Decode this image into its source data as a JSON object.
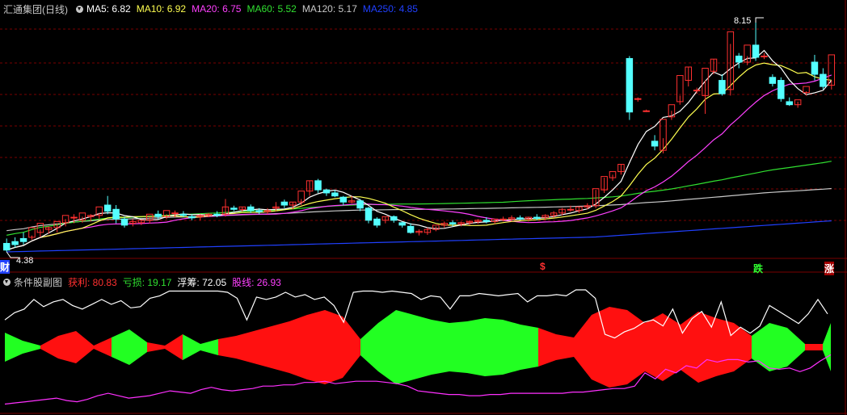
{
  "main_header": {
    "title": "汇通集团(日线)",
    "ma5": "MA5: 6.82",
    "ma10": "MA10: 6.92",
    "ma20": "MA20: 6.75",
    "ma60": "MA60: 5.52",
    "ma120": "MA120: 5.17",
    "ma250": "MA250: 4.85"
  },
  "sub_header": {
    "title": "条件股副图",
    "profit": "获利: 80.83",
    "loss": "亏损: 19.17",
    "float": "浮筹: 72.05",
    "stock_line": "股线: 26.93"
  },
  "annotations": {
    "high_price": "8.15",
    "low_price": "4.38",
    "left_marker": "财",
    "signal_dollar": "$",
    "signal_fall": "跌",
    "signal_rise": "涨"
  },
  "colors": {
    "up": "#ff3030",
    "down": "#54ffff",
    "ma5": "#ffffff",
    "ma10": "#ffff50",
    "ma20": "#ff40ff",
    "ma60": "#30e030",
    "ma120": "#c8c8c8",
    "ma250": "#2040ff",
    "grid": "#7a0000"
  },
  "chart_data": {
    "type": "candlestick",
    "price_range": [
      4.38,
      8.15
    ],
    "candles": [
      [
        4.52,
        4.6,
        4.41,
        4.38
      ],
      [
        4.55,
        4.62,
        4.5,
        4.45
      ],
      [
        4.6,
        4.7,
        4.55,
        4.5
      ],
      [
        4.62,
        4.65,
        4.78,
        4.58
      ],
      [
        4.7,
        4.75,
        4.85,
        4.62
      ],
      [
        4.75,
        4.8,
        4.78,
        4.68
      ],
      [
        4.78,
        4.85,
        4.88,
        4.7
      ],
      [
        4.86,
        4.92,
        4.98,
        4.8
      ],
      [
        4.95,
        5.0,
        4.95,
        4.85
      ],
      [
        4.9,
        4.96,
        5.02,
        4.86
      ],
      [
        4.96,
        5.0,
        4.98,
        4.88
      ],
      [
        4.98,
        5.02,
        5.12,
        4.92
      ],
      [
        5.15,
        5.3,
        5.05,
        5.0
      ],
      [
        5.08,
        5.15,
        4.92,
        4.85
      ],
      [
        4.92,
        4.96,
        4.82,
        4.78
      ],
      [
        4.85,
        4.92,
        4.88,
        4.8
      ],
      [
        4.86,
        4.9,
        4.9,
        4.82
      ],
      [
        4.9,
        4.95,
        5.0,
        4.85
      ],
      [
        5.0,
        5.06,
        4.96,
        4.92
      ],
      [
        4.96,
        5.0,
        5.06,
        4.92
      ],
      [
        5.02,
        5.06,
        5.02,
        4.95
      ],
      [
        5.0,
        5.05,
        4.98,
        4.95
      ],
      [
        4.96,
        5.0,
        4.94,
        4.9
      ],
      [
        4.96,
        5.0,
        4.98,
        4.9
      ],
      [
        4.98,
        5.02,
        5.0,
        4.95
      ],
      [
        5.0,
        5.05,
        4.98,
        4.95
      ],
      [
        5.0,
        5.25,
        5.12,
        4.96
      ],
      [
        5.1,
        5.14,
        5.08,
        5.05
      ],
      [
        5.08,
        5.12,
        5.12,
        5.04
      ],
      [
        5.12,
        5.16,
        5.06,
        5.02
      ],
      [
        5.06,
        5.1,
        5.04,
        5.0
      ],
      [
        5.04,
        5.1,
        5.06,
        5.0
      ],
      [
        5.1,
        5.2,
        5.12,
        5.05
      ],
      [
        5.2,
        5.24,
        5.15,
        5.1
      ],
      [
        5.15,
        5.2,
        5.2,
        5.08
      ],
      [
        5.2,
        5.25,
        5.38,
        5.15
      ],
      [
        5.38,
        5.55,
        5.55,
        5.3
      ],
      [
        5.55,
        5.58,
        5.4,
        5.35
      ],
      [
        5.4,
        5.42,
        5.35,
        5.3
      ],
      [
        5.35,
        5.4,
        5.3,
        5.28
      ],
      [
        5.28,
        5.3,
        5.2,
        5.15
      ],
      [
        5.2,
        5.3,
        5.22,
        5.18
      ],
      [
        5.22,
        5.25,
        5.1,
        5.05
      ],
      [
        5.1,
        5.12,
        4.9,
        4.85
      ],
      [
        4.92,
        4.95,
        4.82,
        4.78
      ],
      [
        4.9,
        4.95,
        4.96,
        4.85
      ],
      [
        4.96,
        4.98,
        4.9,
        4.86
      ],
      [
        4.86,
        4.88,
        4.82,
        4.78
      ],
      [
        4.8,
        4.85,
        4.7,
        4.68
      ],
      [
        4.7,
        4.75,
        4.72,
        4.65
      ],
      [
        4.7,
        4.78,
        4.75,
        4.66
      ],
      [
        4.75,
        4.8,
        4.82,
        4.72
      ],
      [
        4.82,
        4.88,
        4.85,
        4.78
      ],
      [
        4.86,
        4.9,
        4.84,
        4.8
      ],
      [
        4.84,
        4.88,
        4.86,
        4.8
      ],
      [
        4.86,
        4.9,
        4.88,
        4.82
      ],
      [
        4.88,
        4.92,
        4.9,
        4.84
      ],
      [
        4.9,
        4.95,
        4.88,
        4.85
      ],
      [
        4.88,
        4.92,
        4.92,
        4.84
      ],
      [
        4.92,
        4.96,
        4.92,
        4.88
      ],
      [
        4.92,
        4.98,
        4.94,
        4.88
      ],
      [
        4.94,
        4.98,
        4.92,
        4.9
      ],
      [
        4.92,
        4.96,
        4.95,
        4.88
      ],
      [
        4.95,
        5.0,
        4.93,
        4.9
      ],
      [
        4.95,
        5.0,
        4.98,
        4.9
      ],
      [
        4.98,
        5.05,
        5.02,
        4.94
      ],
      [
        5.02,
        5.1,
        5.08,
        4.98
      ],
      [
        5.08,
        5.14,
        5.08,
        5.04
      ],
      [
        5.06,
        5.12,
        5.12,
        5.02
      ],
      [
        5.12,
        5.18,
        5.14,
        5.08
      ],
      [
        5.14,
        5.4,
        5.42,
        5.1
      ],
      [
        5.4,
        5.6,
        5.62,
        5.35
      ],
      [
        5.6,
        5.65,
        5.7,
        5.55
      ],
      [
        5.7,
        5.82,
        5.82,
        5.65
      ],
      [
        7.56,
        7.6,
        6.68,
        6.55
      ],
      [
        6.9,
        6.92,
        6.9,
        6.85
      ],
      [
        6.7,
        6.72,
        6.7,
        6.68
      ],
      [
        6.2,
        6.3,
        6.12,
        6.05
      ],
      [
        6.05,
        6.25,
        6.56,
        6.0
      ],
      [
        6.6,
        6.7,
        6.8,
        6.55
      ],
      [
        6.85,
        6.95,
        7.28,
        6.8
      ],
      [
        7.2,
        7.42,
        7.42,
        7.1
      ],
      [
        7.04,
        7.08,
        7.04,
        6.98
      ],
      [
        6.95,
        7.2,
        7.4,
        6.65
      ],
      [
        7.35,
        7.55,
        7.55,
        7.3
      ],
      [
        7.2,
        7.3,
        6.98,
        6.95
      ],
      [
        7.05,
        7.8,
        8.0,
        6.95
      ],
      [
        7.6,
        7.65,
        7.5,
        7.4
      ],
      [
        7.5,
        7.6,
        7.78,
        7.45
      ],
      [
        7.78,
        8.15,
        7.58,
        7.52
      ],
      [
        7.6,
        7.65,
        7.6,
        7.55
      ],
      [
        7.25,
        7.3,
        7.15,
        7.1
      ],
      [
        7.2,
        7.25,
        6.9,
        6.85
      ],
      [
        6.85,
        6.92,
        6.8,
        6.78
      ],
      [
        6.8,
        6.85,
        6.88,
        6.75
      ],
      [
        7.0,
        7.02,
        7.1,
        6.95
      ],
      [
        7.5,
        7.62,
        7.3,
        7.2
      ],
      [
        7.3,
        7.4,
        7.1,
        7.05
      ],
      [
        7.12,
        7.2,
        7.62,
        7.05
      ]
    ],
    "sub_range": [
      0,
      100
    ],
    "profit_line": [
      73,
      79,
      82,
      90,
      84,
      88,
      90,
      85,
      82,
      86,
      90,
      86,
      89,
      83,
      84,
      91,
      93,
      97,
      97,
      97,
      97,
      97,
      97,
      96,
      91,
      73,
      92,
      90,
      92,
      96,
      92,
      94,
      90,
      92,
      85,
      71,
      96,
      97,
      97,
      96,
      97,
      96,
      95,
      90,
      93,
      92,
      82,
      93,
      93,
      95,
      94,
      93,
      94,
      95,
      88,
      93,
      93,
      94,
      93,
      98,
      98,
      91,
      61,
      58,
      63,
      66,
      71,
      73,
      68,
      82,
      62,
      74,
      80,
      67,
      88,
      60,
      67,
      62,
      68,
      85,
      80,
      75,
      70,
      78,
      90,
      78
    ],
    "stock_line": [
      3,
      4,
      5,
      6,
      7,
      8,
      6,
      5,
      7,
      10,
      12,
      10,
      8,
      9,
      10,
      12,
      14,
      13,
      12,
      15,
      17,
      15,
      14,
      15,
      16,
      18,
      18,
      19,
      19,
      21,
      21,
      22,
      20,
      21,
      22,
      22,
      22,
      21,
      20,
      18,
      14,
      13,
      12,
      11,
      11,
      10,
      10,
      11,
      11,
      12,
      12,
      12,
      12,
      12,
      12,
      13,
      13,
      14,
      15,
      16,
      16,
      18,
      29,
      24,
      32,
      29,
      35,
      33,
      40,
      38,
      40,
      40,
      38,
      39,
      33,
      32,
      33,
      30,
      33,
      39,
      44
    ]
  }
}
